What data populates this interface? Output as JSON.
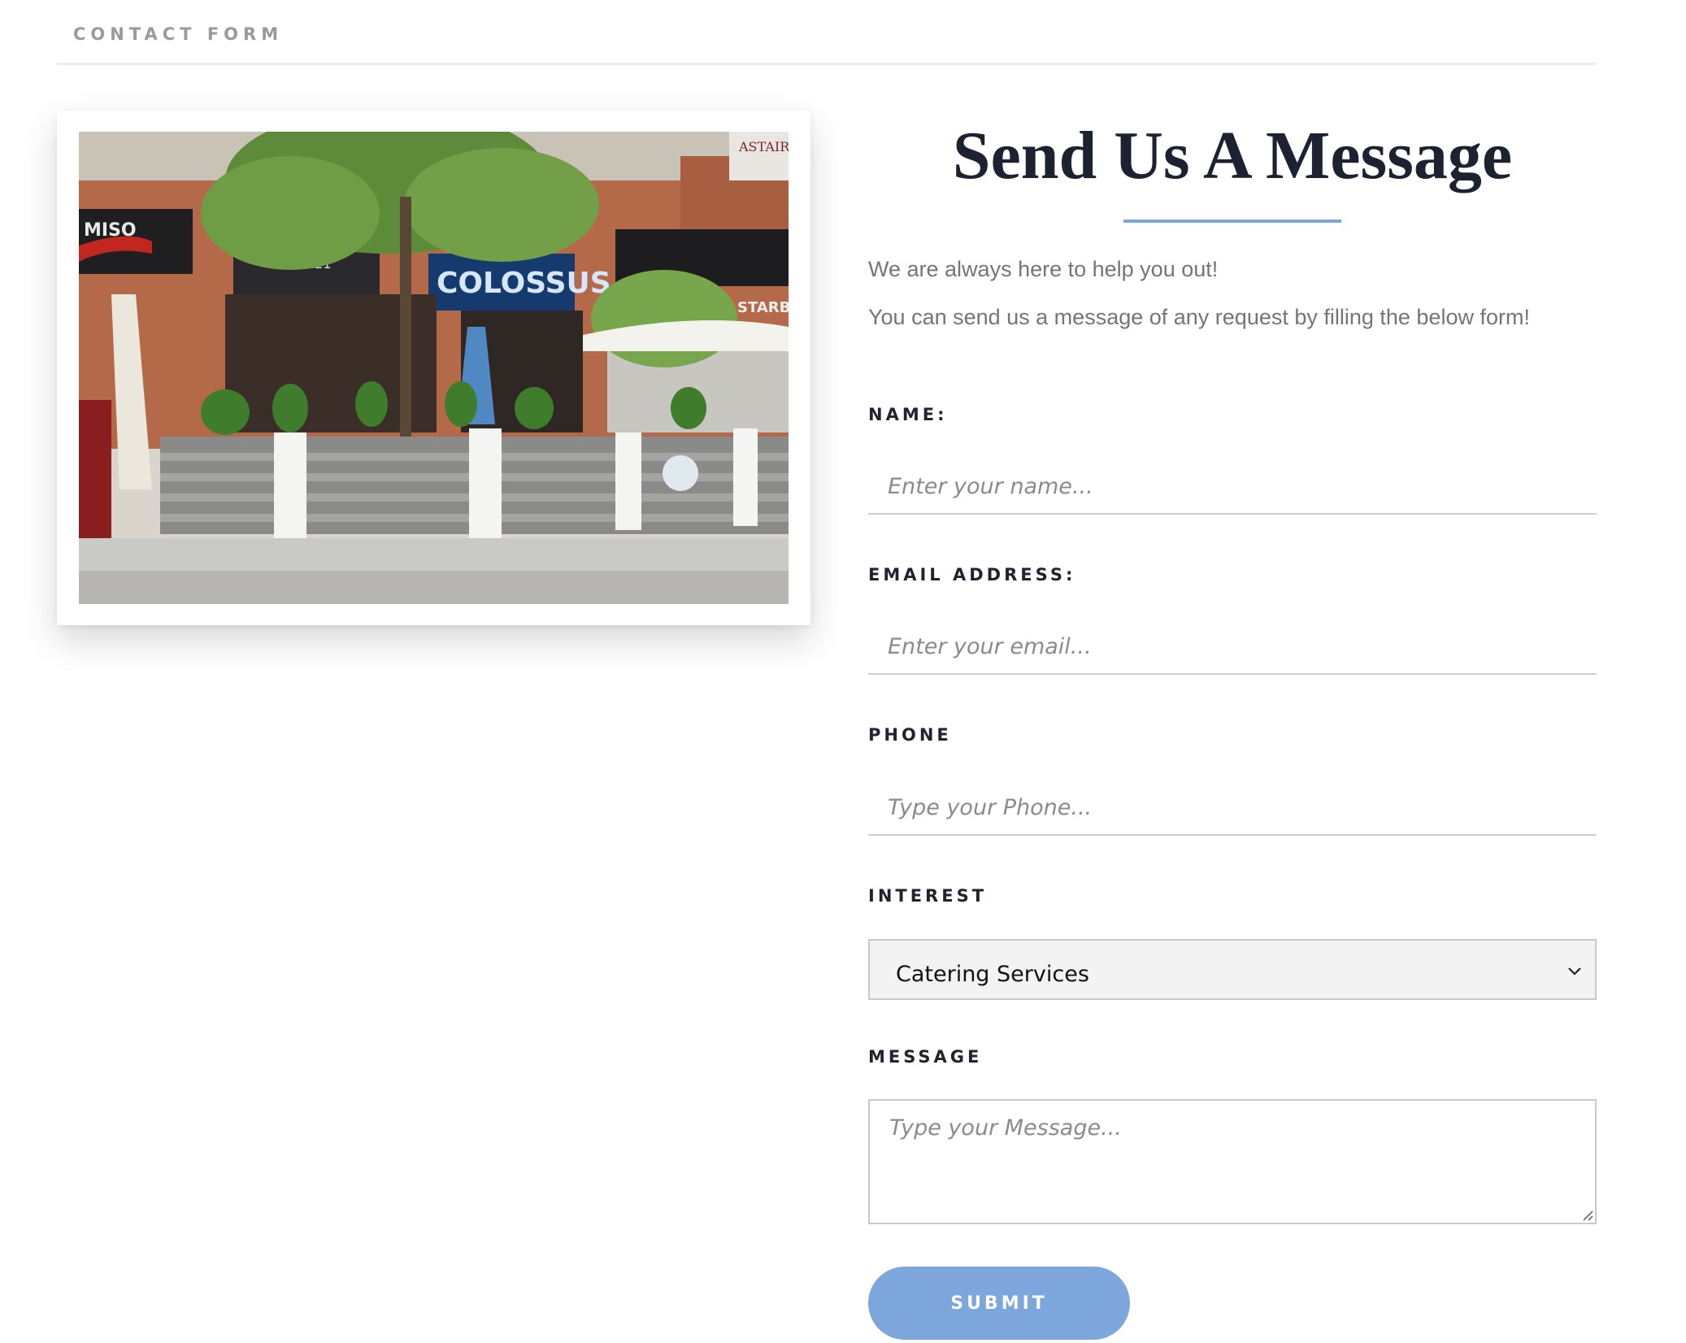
{
  "section": {
    "title": "CONTACT FORM"
  },
  "hero": {
    "image_alt": "Storefront patio of Colossus Greek Taverna with trees, planters and umbrellas"
  },
  "form": {
    "heading": "Send Us A Message",
    "intro_line1": "We are always here to help you out!",
    "intro_line2": "You can send us a message of any request by filling the below form!",
    "name": {
      "label": "NAME:",
      "placeholder": "Enter your name...",
      "value": ""
    },
    "email": {
      "label": "EMAIL ADDRESS:",
      "placeholder": "Enter your email...",
      "value": ""
    },
    "phone": {
      "label": "PHONE",
      "placeholder": "Type your Phone...",
      "value": ""
    },
    "interest": {
      "label": "INTEREST",
      "selected": "Catering Services"
    },
    "message": {
      "label": "MESSAGE",
      "placeholder": "Type your Message...",
      "value": ""
    },
    "submit_label": "SUBMIT"
  },
  "photo_signs": {
    "main": "COLOSSUS",
    "left": "MISO",
    "right": "STARBUC",
    "number": "221",
    "corner": "ASTAIRE"
  },
  "colors": {
    "accent": "#7da6da",
    "heading": "#1c2230",
    "muted": "#74757a",
    "label": "#1f2430"
  }
}
